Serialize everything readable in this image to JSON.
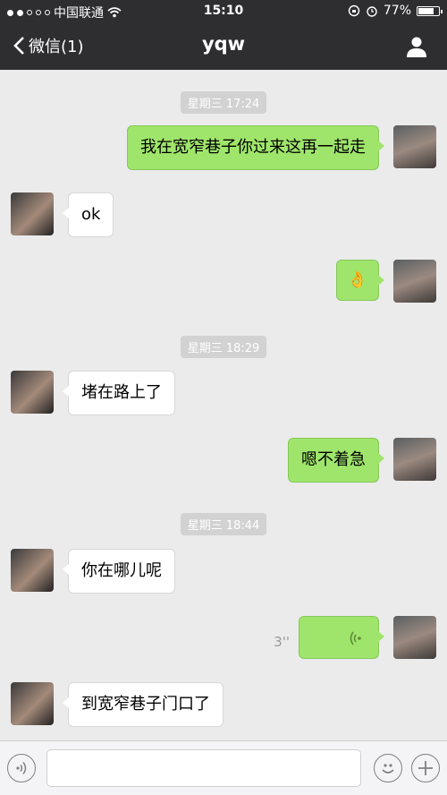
{
  "status_bar": {
    "carrier": "中国联通",
    "time": "15:10",
    "battery": "77%",
    "battery_level": 0.77
  },
  "nav": {
    "back_label": "微信(1)",
    "title": "yqw"
  },
  "timestamps": [
    "星期三 17:24",
    "星期三 18:29",
    "星期三 18:44"
  ],
  "messages": {
    "m1": "我在宽窄巷子你过来这再一起走",
    "m2": "ok",
    "m3_emoji": "👌",
    "m4": "堵在路上了",
    "m5": "嗯不着急",
    "m6": "你在哪儿呢",
    "m7_duration": "3''",
    "m8": "到宽窄巷子门口了"
  },
  "icons": {
    "back": "chevron-left-icon",
    "profile": "person-icon",
    "voice_input": "voice-icon",
    "emoji": "smiley-icon",
    "more": "plus-icon"
  },
  "colors": {
    "nav_bg": "#2e2e31",
    "chat_bg": "#ebebeb",
    "out_bubble": "#9fe56b",
    "in_bubble": "#ffffff"
  }
}
